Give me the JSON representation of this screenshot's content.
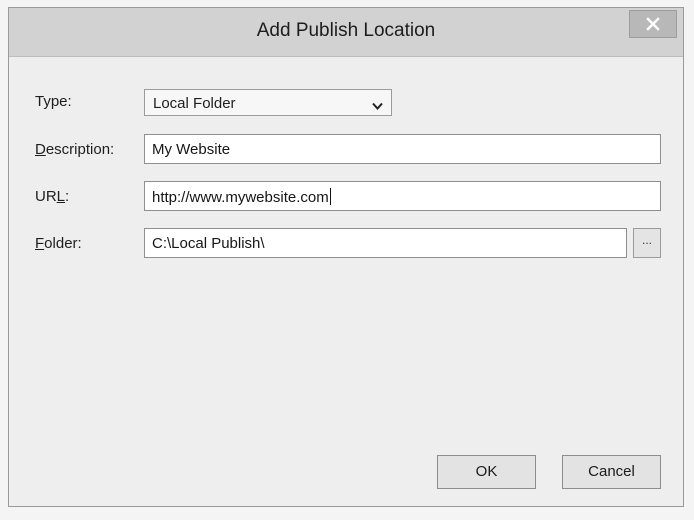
{
  "window": {
    "title": "Add Publish Location"
  },
  "form": {
    "type": {
      "label": "Type:",
      "value": "Local Folder"
    },
    "description": {
      "label_accel": "D",
      "label_rest": "escription:",
      "value": "My Website"
    },
    "url": {
      "label_pre": "UR",
      "label_accel": "L",
      "label_post": ":",
      "value": "http://www.mywebsite.com"
    },
    "folder": {
      "label_accel": "F",
      "label_rest": "older:",
      "value": "C:\\Local Publish\\",
      "browse_label": "..."
    }
  },
  "buttons": {
    "ok_label": "OK",
    "cancel_label": "Cancel"
  },
  "icons": {
    "close": "close-icon",
    "dropdown": "chevron-down-icon"
  },
  "colors": {
    "close_button": "#b8b8b8",
    "dialog_background": "#eeeeee"
  }
}
